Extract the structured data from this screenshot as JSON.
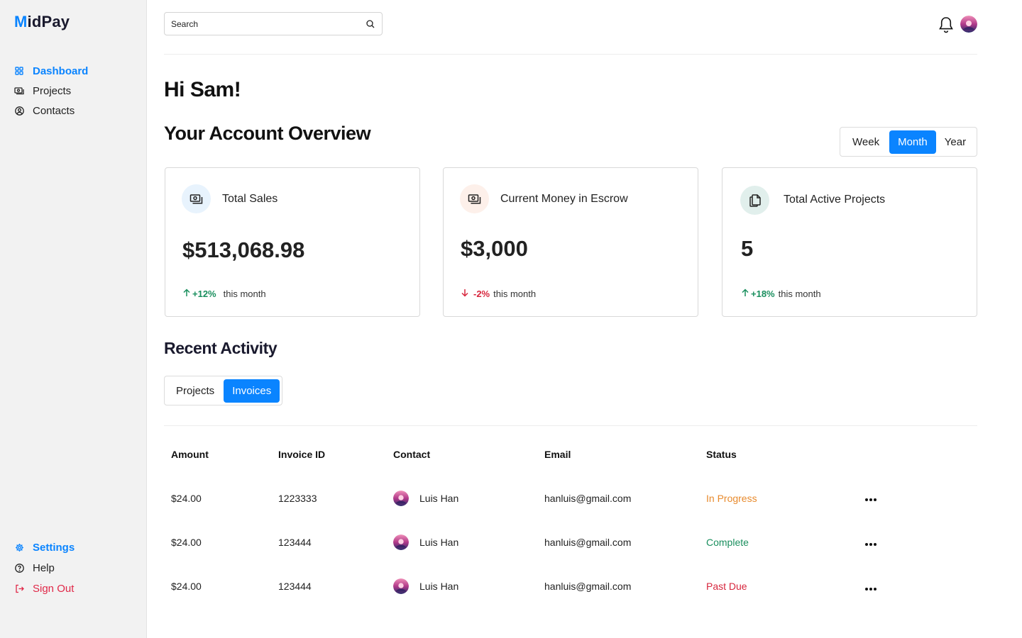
{
  "app": {
    "logo_text": "MidPay",
    "logo_first": "M",
    "logo_rest": "idPay"
  },
  "sidebar": {
    "top_items": [
      {
        "label": "Dashboard",
        "icon": "grid-icon",
        "active": true
      },
      {
        "label": "Projects",
        "icon": "cash-icon"
      },
      {
        "label": "Contacts",
        "icon": "user-circle-icon"
      }
    ],
    "bottom_items": [
      {
        "label": "Settings",
        "icon": "gear-icon",
        "active": true
      },
      {
        "label": "Help",
        "icon": "help-circle-icon"
      },
      {
        "label": "Sign Out",
        "icon": "sign-out-icon",
        "danger": true
      }
    ]
  },
  "header": {
    "search_placeholder": "Search",
    "search_icon": "search-icon",
    "bell_icon": "bell-icon"
  },
  "greeting": "Hi Sam!",
  "overview": {
    "title": "Your Account Overview",
    "periods": [
      "Week",
      "Month",
      "Year"
    ],
    "selected_period": "Month",
    "cards": [
      {
        "title": "Total Sales",
        "value": "$513,068.98",
        "trend": "+12%",
        "direction": "up",
        "suffix": "this month",
        "icon": "cash-icon",
        "badge_color": "#e8f3fd"
      },
      {
        "title": "Current Money in Escrow",
        "value": "$3,000",
        "trend": "-2%",
        "direction": "down",
        "suffix": "this month",
        "icon": "cash-icon",
        "badge_color": "#fdf0ea"
      },
      {
        "title": "Total Active Projects",
        "value": "5",
        "trend": "+18%",
        "direction": "up",
        "suffix": "this month",
        "icon": "documents-icon",
        "badge_color": "#e1efec"
      }
    ]
  },
  "recent": {
    "title": "Recent Activity",
    "tabs": [
      "Projects",
      "Invoices"
    ],
    "selected_tab": "Invoices",
    "columns": [
      "Amount",
      "Invoice ID",
      "Contact",
      "Email",
      "Status"
    ],
    "rows": [
      {
        "amount": "$24.00",
        "invoice_id": "1223333",
        "contact": "Luis Han",
        "email": "hanluis@gmail.com",
        "status": "In Progress"
      },
      {
        "amount": "$24.00",
        "invoice_id": "123444",
        "contact": "Luis Han",
        "email": "hanluis@gmail.com",
        "status": "Complete"
      },
      {
        "amount": "$24.00",
        "invoice_id": "123444",
        "contact": "Luis Han",
        "email": "hanluis@gmail.com",
        "status": "Past Due"
      }
    ]
  },
  "colors": {
    "accent": "#0a84ff",
    "up": "#1a8f5e",
    "down": "#d7263d",
    "in_progress": "#e88a2c",
    "complete": "#1a8f5e",
    "past_due": "#d7263d",
    "sign_out": "#e02848"
  }
}
